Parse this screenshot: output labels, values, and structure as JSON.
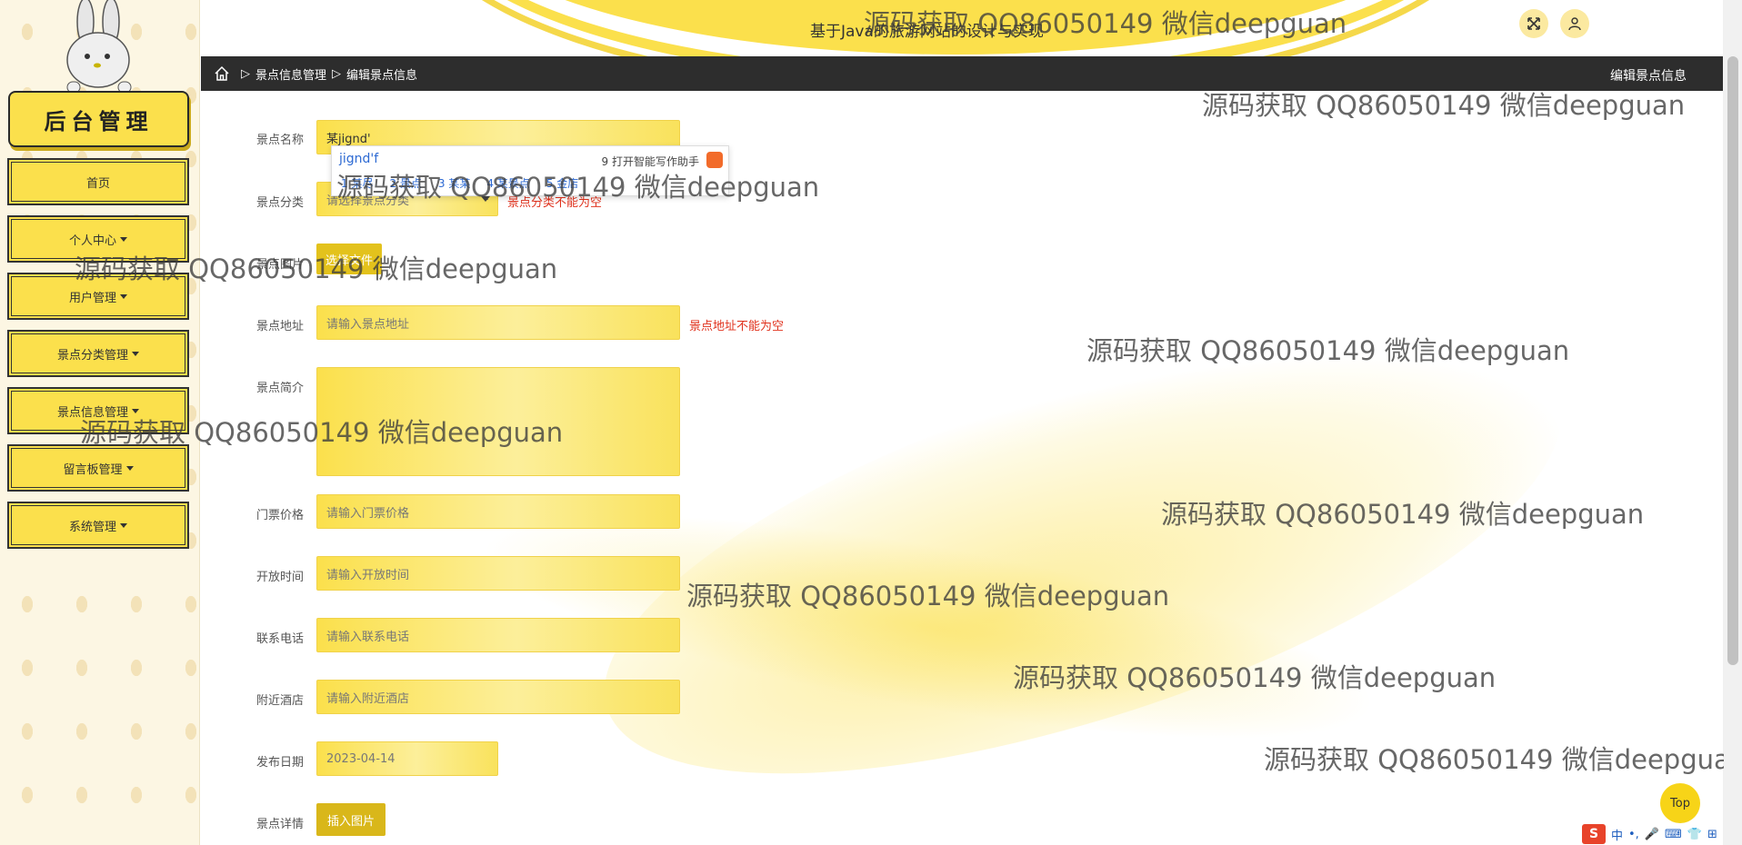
{
  "sidebar": {
    "brand": "后台管理",
    "menu": [
      {
        "label": "首页",
        "dropdown": false
      },
      {
        "label": "个人中心",
        "dropdown": true
      },
      {
        "label": "用户管理",
        "dropdown": true
      },
      {
        "label": "景点分类管理",
        "dropdown": true
      },
      {
        "label": "景点信息管理",
        "dropdown": true
      },
      {
        "label": "留言板管理",
        "dropdown": true
      },
      {
        "label": "系统管理",
        "dropdown": true
      }
    ]
  },
  "header": {
    "title": "基于Java的旅游网站的设计与实现",
    "icons": [
      "fullscreen-icon",
      "user-icon"
    ]
  },
  "breadcrumb": {
    "items": [
      "景点信息管理",
      "编辑景点信息"
    ],
    "page_title": "编辑景点信息"
  },
  "form": {
    "name_label": "景点名称",
    "name_value": "某jignd'",
    "category_label": "景点分类",
    "category_placeholder": "请选择景点分类",
    "category_error": "景点分类不能为空",
    "image_label": "景点图片",
    "image_button": "选择文件",
    "address_label": "景点地址",
    "address_placeholder": "请输入景点地址",
    "address_error": "景点地址不能为空",
    "intro_label": "景点简介",
    "price_label": "门票价格",
    "price_placeholder": "请输入门票价格",
    "hours_label": "开放时间",
    "hours_placeholder": "请输入开放时间",
    "phone_label": "联系电话",
    "phone_placeholder": "请输入联系电话",
    "hotel_label": "附近酒店",
    "hotel_placeholder": "请输入附近酒店",
    "date_label": "发布日期",
    "date_value": "2023-04-14",
    "detail_label": "景点详情",
    "insert_image_button": "插入图片"
  },
  "ime": {
    "composition": "jignd'f",
    "assistant": "9 打开智能写作助手",
    "candidates": [
      "1 某尽",
      "2 景点",
      "3 某某",
      "4 某景点",
      "5 金店"
    ]
  },
  "watermark": "源码获取 QQ86050149 微信deepguan",
  "top_button": "Top",
  "taskbar": {
    "ime_logo": "S",
    "items": [
      "中",
      "•,",
      "🎤",
      "⌨",
      "👕",
      "⊞"
    ]
  },
  "colors": {
    "accent": "#fbe04c",
    "dark_bar": "#2d2d2d",
    "error": "#e0311c"
  }
}
